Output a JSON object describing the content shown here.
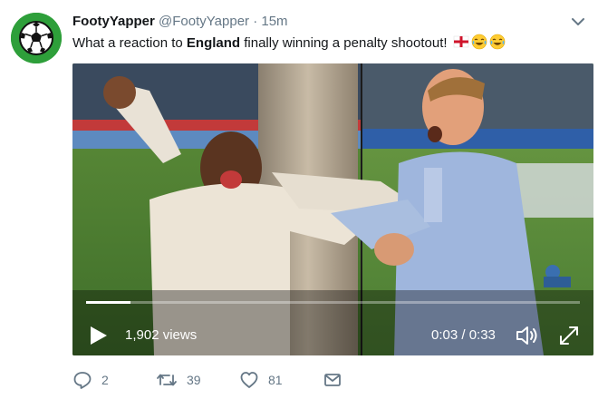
{
  "tweet": {
    "author": {
      "name": "FootyYapper",
      "handle": "@FootyYapper",
      "avatar_icon": "soccer-ball-icon"
    },
    "separator": "·",
    "time": "15m",
    "text": {
      "before": "What a reaction to ",
      "bold": "England",
      "after": " finally winning a penalty shootout! ",
      "emojis": [
        "england-flag-icon",
        "tears-of-joy-icon",
        "tears-of-joy-icon"
      ]
    },
    "video": {
      "views": "1,902 views",
      "time_display": "0:03 / 0:33",
      "progress": 0.09,
      "controls": [
        "play-icon",
        "volume-icon",
        "fullscreen-icon"
      ]
    },
    "actions": {
      "reply_count": "2",
      "retweet_count": "39",
      "like_count": "81"
    }
  }
}
